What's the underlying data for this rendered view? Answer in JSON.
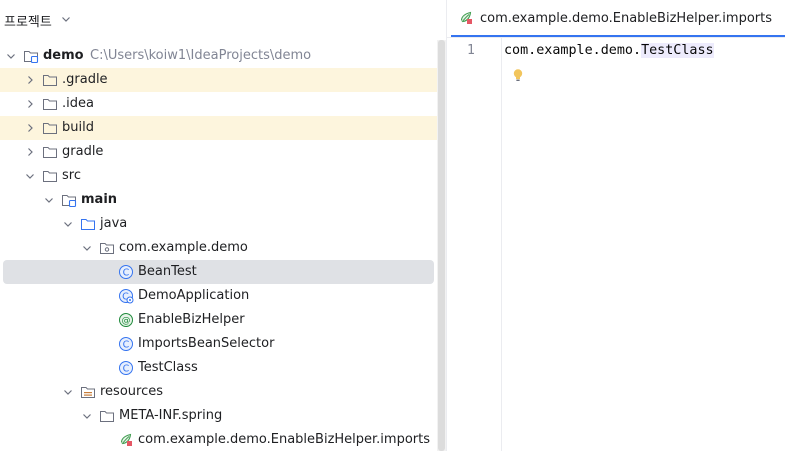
{
  "project_panel": {
    "title": "프로젝트",
    "tree": [
      {
        "label": "demo",
        "path": "C:\\Users\\koiw1\\IdeaProjects\\demo",
        "indent": 0,
        "arrow": "down",
        "icon": "module-folder-icon",
        "bold": true,
        "row": "normal"
      },
      {
        "label": ".gradle",
        "indent": 1,
        "arrow": "right",
        "icon": "folder-icon",
        "row": "highlight"
      },
      {
        "label": ".idea",
        "indent": 1,
        "arrow": "right",
        "icon": "folder-icon",
        "row": "normal"
      },
      {
        "label": "build",
        "indent": 1,
        "arrow": "right",
        "icon": "folder-icon",
        "row": "highlight"
      },
      {
        "label": "gradle",
        "indent": 1,
        "arrow": "right",
        "icon": "folder-icon",
        "row": "normal"
      },
      {
        "label": "src",
        "indent": 1,
        "arrow": "down",
        "icon": "folder-icon",
        "row": "normal"
      },
      {
        "label": "main",
        "indent": 2,
        "arrow": "down",
        "icon": "module-folder-icon",
        "bold": true,
        "row": "normal"
      },
      {
        "label": "java",
        "indent": 3,
        "arrow": "down",
        "icon": "source-folder-icon",
        "row": "normal"
      },
      {
        "label": "com.example.demo",
        "indent": 4,
        "arrow": "down",
        "icon": "package-icon",
        "row": "normal"
      },
      {
        "label": "BeanTest",
        "indent": 5,
        "arrow": "none",
        "icon": "class-icon",
        "row": "selected"
      },
      {
        "label": "DemoApplication",
        "indent": 5,
        "arrow": "none",
        "icon": "spring-boot-class-icon",
        "row": "normal"
      },
      {
        "label": "EnableBizHelper",
        "indent": 5,
        "arrow": "none",
        "icon": "annotation-icon",
        "row": "normal"
      },
      {
        "label": "ImportsBeanSelector",
        "indent": 5,
        "arrow": "none",
        "icon": "class-icon",
        "row": "normal"
      },
      {
        "label": "TestClass",
        "indent": 5,
        "arrow": "none",
        "icon": "class-icon",
        "row": "normal"
      },
      {
        "label": "resources",
        "indent": 3,
        "arrow": "down",
        "icon": "resources-folder-icon",
        "row": "normal"
      },
      {
        "label": "META-INF.spring",
        "indent": 4,
        "arrow": "down",
        "icon": "folder-icon",
        "row": "normal"
      },
      {
        "label": "com.example.demo.EnableBizHelper.imports",
        "indent": 5,
        "arrow": "none",
        "icon": "imports-file-icon",
        "row": "normal"
      }
    ]
  },
  "editor": {
    "tab_label": "com.example.demo.EnableBizHelper.imports",
    "line_number": "1",
    "code_prefix": "com.example.demo.",
    "code_class": "TestClass"
  },
  "colors": {
    "accent": "#3574f0",
    "highlight_row": "#fdf5dd",
    "selected_row": "#dfe1e5",
    "folder_stroke": "#6c707e",
    "class_icon": "#3574f0",
    "annotation_icon": "#208a3c"
  }
}
